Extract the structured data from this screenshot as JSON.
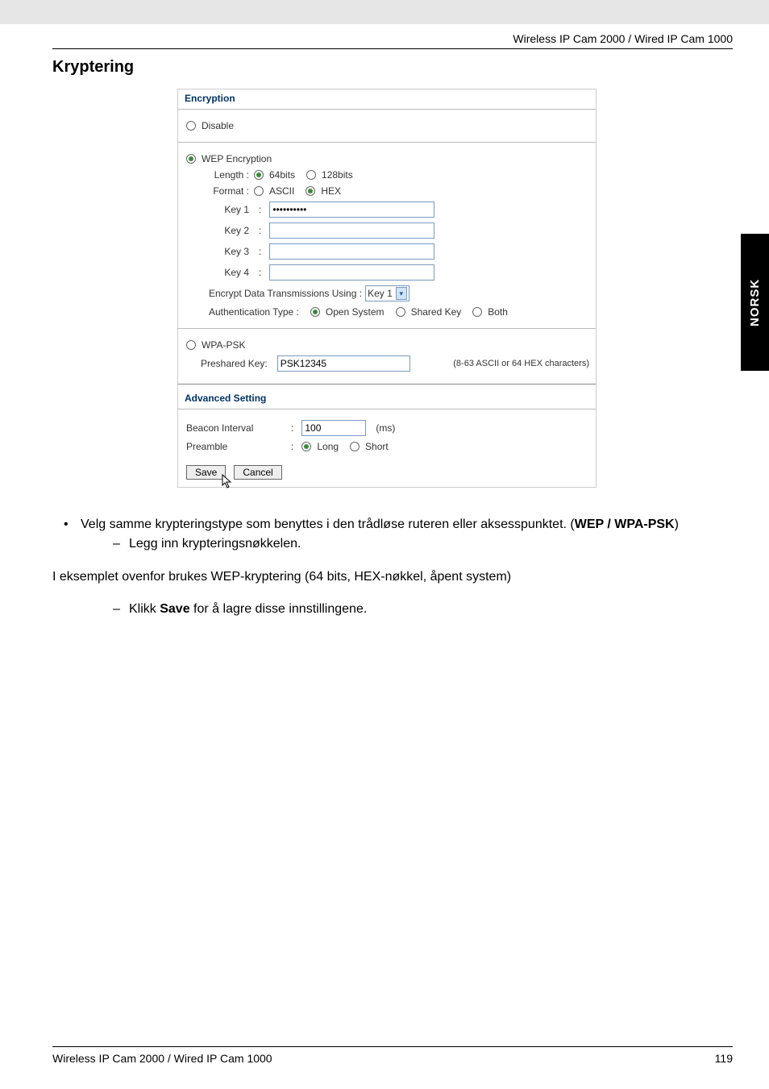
{
  "header": {
    "product": "Wireless IP Cam 2000 / Wired IP Cam 1000"
  },
  "heading": "Kryptering",
  "sidetab": "NORSK",
  "panel": {
    "encryption_title": "Encryption",
    "disable_label": "Disable",
    "wep_label": "WEP Encryption",
    "length_label": "Length :",
    "length_64": "64bits",
    "length_128": "128bits",
    "format_label": "Format :",
    "format_ascii": "ASCII",
    "format_hex": "HEX",
    "key1_label": "Key 1",
    "key2_label": "Key 2",
    "key3_label": "Key 3",
    "key4_label": "Key 4",
    "key1_value": "••••••••••",
    "encrypt_using_label": "Encrypt Data Transmissions Using  :",
    "encrypt_using_value": "Key 1",
    "auth_label": "Authentication Type  :",
    "auth_open": "Open System",
    "auth_shared": "Shared Key",
    "auth_both": "Both",
    "wpa_label": "WPA-PSK",
    "psk_label": "Preshared Key:",
    "psk_value": "PSK12345",
    "psk_hint": "(8-63 ASCII or 64 HEX characters)",
    "adv_title": "Advanced Setting",
    "beacon_label": "Beacon Interval",
    "beacon_value": "100",
    "beacon_unit": "(ms)",
    "preamble_label": "Preamble",
    "preamble_long": "Long",
    "preamble_short": "Short",
    "save_btn": "Save",
    "cancel_btn": "Cancel"
  },
  "body": {
    "bullet1_a": "Velg samme krypteringstype som benyttes i den trådløse ruteren eller aksesspunktet. (",
    "bullet1_bold": "WEP / WPA-PSK",
    "bullet1_b": ")",
    "dash1": "Legg inn krypteringsnøkkelen.",
    "para": "I eksemplet ovenfor brukes WEP-kryptering (64 bits, HEX-nøkkel, åpent system)",
    "dash2_a": "Klikk ",
    "dash2_bold": "Save",
    "dash2_b": " for å lagre disse innstillingene."
  },
  "footer": {
    "left": "Wireless IP Cam 2000 / Wired IP Cam 1000",
    "page": "119"
  }
}
